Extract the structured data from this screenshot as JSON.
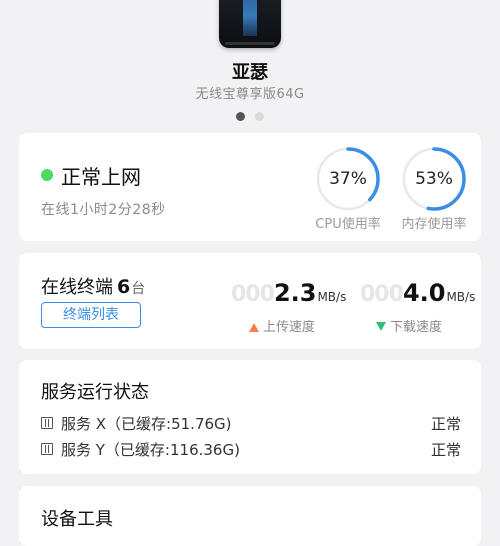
{
  "device": {
    "name": "亚瑟",
    "model": "无线宝尊享版64G",
    "carousel_active_index": 0,
    "carousel_count": 2
  },
  "network": {
    "status": "正常上网",
    "online_time": "在线1小时2分28秒",
    "cpu": {
      "value": 37,
      "display": "37%",
      "label": "CPU使用率"
    },
    "memory": {
      "value": 53,
      "display": "53%",
      "label": "内存使用率"
    }
  },
  "terminals": {
    "label": "在线终端",
    "count": "6",
    "unit": "台",
    "button": "终端列表"
  },
  "speed": {
    "upload": {
      "zeros": "000",
      "value": "2.3",
      "unit": "MB/s",
      "label": "上传速度"
    },
    "download": {
      "zeros": "000",
      "value": "4.0",
      "unit": "MB/s",
      "label": "下载速度"
    }
  },
  "services": {
    "title": "服务运行状态",
    "items": [
      {
        "name": "服务 X（已缓存:51.76G)",
        "status": "正常"
      },
      {
        "name": "服务 Y（已缓存:116.36G)",
        "status": "正常"
      }
    ]
  },
  "tools": {
    "title": "设备工具"
  },
  "colors": {
    "accent": "#3a8ee6",
    "status_ok": "#4cd964",
    "upload": "#f0824a",
    "download": "#2dbf7a"
  }
}
